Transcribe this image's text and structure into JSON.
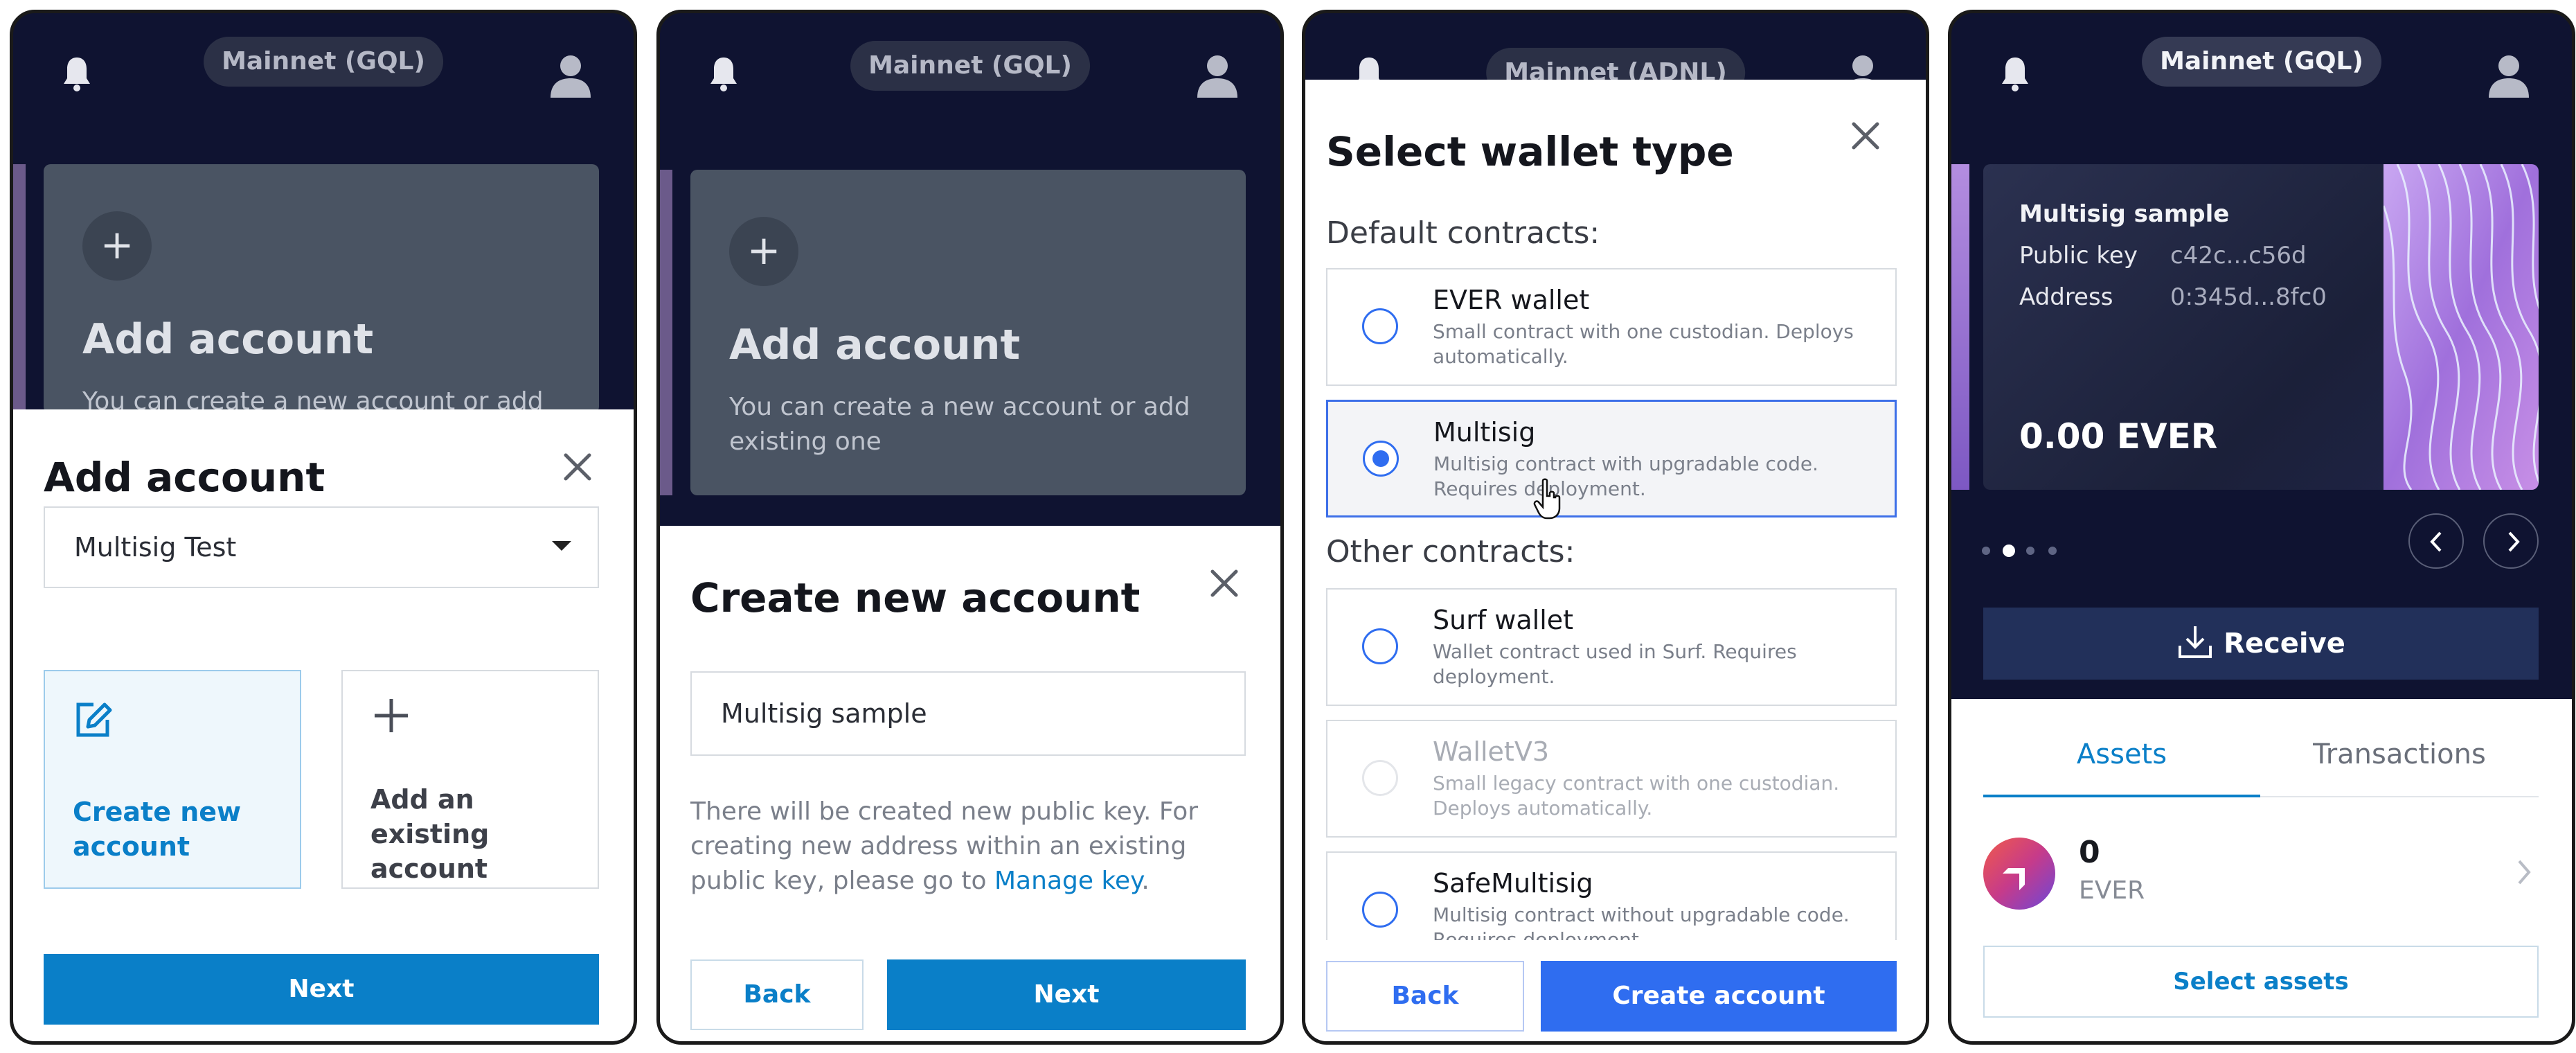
{
  "panel1": {
    "network": "Mainnet (GQL)",
    "bg_card_title": "Add account",
    "bg_card_text": "You can create a new account or add",
    "sheet_title": "Add account",
    "account_select": "Multisig Test",
    "option_create": "Create new account",
    "option_existing": "Add an existing account",
    "next": "Next"
  },
  "panel2": {
    "network": "Mainnet (GQL)",
    "bg_card_title": "Add account",
    "bg_card_text": "You can create a new account or add existing one",
    "sheet_title": "Create new account",
    "name_input": "Multisig sample",
    "hint_text": "There will be created new public key. For creating new address within an existing public key, please go to",
    "hint_link": "Manage key",
    "hint_end": ".",
    "back": "Back",
    "next": "Next"
  },
  "panel3": {
    "network": "Mainnet (ADNL)",
    "sheet_title": "Select wallet type",
    "default_label": "Default contracts:",
    "other_label": "Other contracts:",
    "wallets": [
      {
        "name": "EVER wallet",
        "desc": "Small contract with one custodian. Deploys automatically."
      },
      {
        "name": "Multisig",
        "desc": "Multisig contract with upgradable code. Requires deployment."
      },
      {
        "name": "Surf wallet",
        "desc": "Wallet contract used in Surf. Requires deployment."
      },
      {
        "name": "WalletV3",
        "desc": "Small legacy contract with one custodian. Deploys automatically."
      },
      {
        "name": "SafeMultisig",
        "desc": "Multisig contract without upgradable code. Requires deployment."
      }
    ],
    "selected_index": 1,
    "back": "Back",
    "create": "Create account"
  },
  "panel4": {
    "network": "Mainnet (GQL)",
    "account_name": "Multisig sample",
    "public_key_label": "Public key",
    "public_key": "c42c...c56d",
    "address_label": "Address",
    "address": "0:345d...8fc0",
    "balance": "0.00 EVER",
    "receive": "Receive",
    "tab_assets": "Assets",
    "tab_transactions": "Transactions",
    "asset_amount": "0",
    "asset_ticker": "EVER",
    "select_assets": "Select assets",
    "carousel_pages": 4,
    "carousel_active": 1
  },
  "colors": {
    "dark_bg": "#0f1331",
    "primary": "#0a7fc8",
    "accent_blue": "#2f6df0"
  },
  "icons": [
    "bell-icon",
    "profile-icon",
    "close-icon",
    "chevron-down-icon",
    "edit-icon",
    "plus-icon",
    "download-icon",
    "chevron-left-icon",
    "chevron-right-icon",
    "ever-logo-icon",
    "cursor-icon"
  ]
}
